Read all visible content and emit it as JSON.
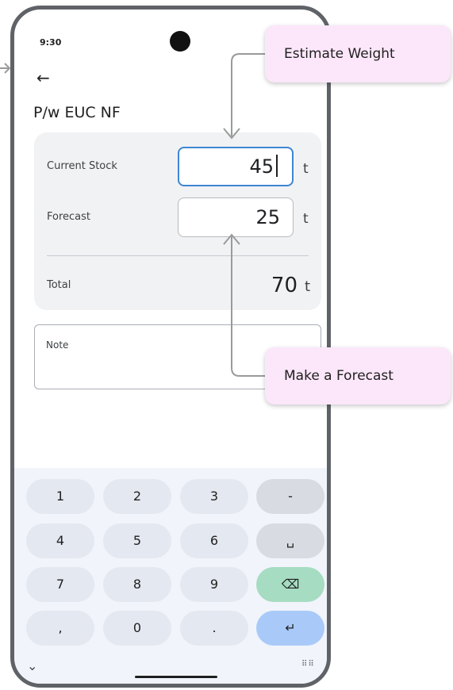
{
  "status": {
    "time": "9:30"
  },
  "header": {
    "back_icon": "arrow-left-icon",
    "title": "P/w EUC NF"
  },
  "card": {
    "current_stock": {
      "label": "Current Stock",
      "value": "45",
      "unit": "t"
    },
    "forecast": {
      "label": "Forecast",
      "value": "25",
      "unit": "t"
    },
    "total": {
      "label": "Total",
      "value": "70",
      "unit": "t"
    }
  },
  "note": {
    "label": "Note"
  },
  "keyboard": {
    "rows": [
      [
        "1",
        "2",
        "3",
        "-"
      ],
      [
        "4",
        "5",
        "6",
        "␣"
      ],
      [
        "7",
        "8",
        "9",
        "⌫"
      ],
      [
        ",",
        "0",
        ".",
        "↵"
      ]
    ],
    "hide_icon": "chevron-down-icon",
    "layout_icon": "keyboard-grid-icon"
  },
  "callouts": {
    "estimate_weight": "Estimate Weight",
    "make_forecast": "Make a Forecast"
  },
  "colors": {
    "accent_blue": "#3d86d3",
    "backspace_green": "#a6dcc2",
    "enter_blue": "#a9caf9",
    "callout_pink": "#fce7fa"
  }
}
